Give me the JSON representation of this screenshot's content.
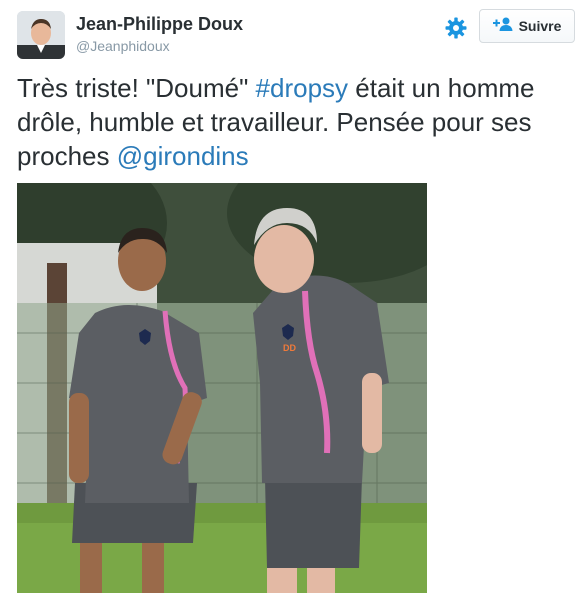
{
  "user": {
    "name": "Jean-Philippe Doux",
    "handle": "@Jeanphidoux"
  },
  "follow_button": {
    "label": "Suivre",
    "icon": "add-user-icon"
  },
  "settings": {
    "icon": "gear-icon"
  },
  "tweet": {
    "text_1": "Très triste! \"Doumé\" ",
    "hashtag": "#dropsy",
    "text_2": " était un homme drôle, humble et travailleur. Pensée pour ses proches ",
    "mention": "@girondins"
  },
  "photo": {
    "badge_text": "DD"
  },
  "colors": {
    "link": "#2b7bb9",
    "gear": "#1b95e0",
    "text": "#292f33",
    "muted": "#8899a6",
    "jersey": "#5b5e63",
    "accent_pink": "#e070b8"
  }
}
